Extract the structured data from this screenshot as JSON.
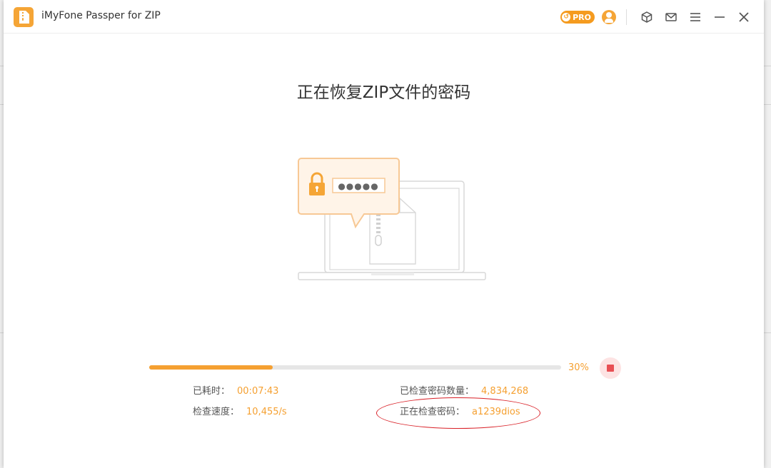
{
  "window": {
    "title": "iMyFone Passper for ZIP"
  },
  "titlebar": {
    "pro_label": "PRO",
    "icons": [
      "pro-badge-icon",
      "user-icon",
      "box-icon",
      "mail-icon",
      "menu-icon",
      "minimize-icon",
      "close-icon"
    ]
  },
  "main": {
    "heading": "正在恢复ZIP文件的密码",
    "illustration": {
      "password_mask": "●●●●●"
    }
  },
  "progress": {
    "percent": 30,
    "percent_label": "30%"
  },
  "stats": {
    "elapsed_label": "已耗时：",
    "elapsed_value": "00:07:43",
    "speed_label": "检查速度：",
    "speed_value": "10,455/s",
    "checked_label": "已检查密码数量：",
    "checked_value": "4,834,268",
    "current_label": "正在检查密码：",
    "current_value": "a1239dios"
  },
  "colors": {
    "accent": "#f5a031",
    "stop": "#e84f54",
    "annotation": "#d92027"
  }
}
